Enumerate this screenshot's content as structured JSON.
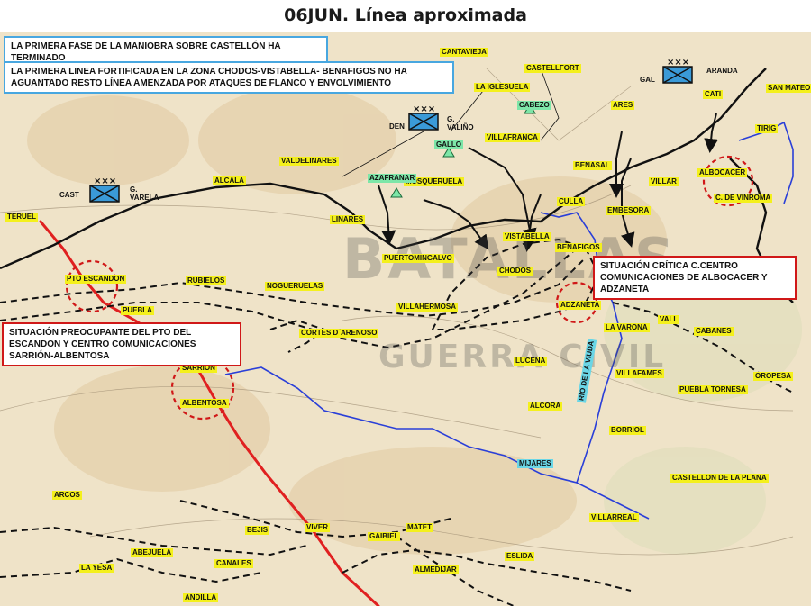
{
  "title": "06JUN. Línea aproximada",
  "notes": {
    "phase_end": "LA  PRIMERA FASE DE LA MANIOBRA SOBRE CASTELLÓN HA TERMINADO",
    "first_line": "LA  PRIMERA LINEA FORTIFICADA  EN LA ZONA CHODOS-VISTABELLA- BENAFIGOS  NO HA AGUANTADO RESTO LÍNEA AMENZADA POR ATAQUES DE FLANCO Y ENVOLVIMIENTO",
    "critical": "SITUACIÓN CRÍTICA C.CENTRO COMUNICACIONES DE ALBOCACER  Y ADZANETA",
    "worrying": "SITUACIÓN PREOCUPANTE  DEL PTO DEL ESCANDON Y CENTRO COMUNICACIONES SARRIÓN-ALBENTOSA"
  },
  "units": [
    {
      "side_label": "CAST",
      "name": "G. VARELA"
    },
    {
      "side_label": "DEN",
      "name": "G. VALIÑO"
    },
    {
      "side_label": "GAL",
      "name": "ARANDA"
    }
  ],
  "watermark": {
    "line1": "BATALLAS",
    "line2": "GUERRA CIVIL"
  },
  "places": {
    "teruel": "TERUEL",
    "pto_escandon": "PTO ESCANDON",
    "puebla": "PUEBLA",
    "sarrion": "SARRION",
    "albentosa": "ALBENTOSA",
    "arcos": "ARCOS",
    "abejuela": "ABEJUELA",
    "la_yesa": "LA YESA",
    "andilla": "ANDILLA",
    "canales": "CANALES",
    "bejis": "BEJIS",
    "viver": "VIVER",
    "gaibiel": "GAIBIEL",
    "matet": "MATET",
    "almedijar": "ALMEDIJAR",
    "eslida": "ESLIDA",
    "villarreal": "VILLARREAL",
    "castellon": "CASTELLON DE LA PLANA",
    "mijares": "MIJARES",
    "borriol": "BORRIOL",
    "puebla_tornesa": "PUEBLA TORNESA",
    "villafames": "VILLAFAMES",
    "alcora": "ALCORA",
    "lucena": "LUCENA",
    "rio_villa": "RIO DE LA VIUDA",
    "la_varona": "LA VARONA",
    "cabanes": "CABANES",
    "oropesa": "OROPESA",
    "vall": "VALL",
    "adzaneta": "ADZANETA",
    "villahermosa": "VILLAHERMOSA",
    "cortes_arenoso": "CORTES D´ARENOSO",
    "noguerelas": "NOGUERUELAS",
    "rubielos": "RUBIELOS",
    "puertomingalvo": "PUERTOMINGALVO",
    "linares": "LINARES",
    "chodos": "CHODOS",
    "vistabella": "VISTABELLA",
    "benafigos": "BENAFIGOS",
    "culla": "CULLA",
    "embesora": "EMBESORA",
    "benasal": "BENASAL",
    "villar": "VILLAR",
    "albocacer": "ALBOCACER",
    "c_vinroma": "C. DE VINROMA",
    "tirig": "TIRIG",
    "cati": "CATI",
    "san_mateo": "SAN MATEO",
    "ares": "ARES",
    "villafranca": "VILLAFRANCA",
    "la_iglesuela": "LA IGLESUELA",
    "cantavieja": "CANTAVIEJA",
    "castellfort": "CASTELLFORT",
    "mosqueruela": "MOSQUERUELA",
    "valdelinares": "VALDELINARES",
    "alcala": "ALCALA",
    "azafranar": "AZAFRANAR",
    "gallo": "GALLO",
    "cabezo": "CABEZO"
  },
  "colors": {
    "front_line": "#111111",
    "road": "#e02020",
    "river": "#2a3fd8",
    "note_blue_border": "#48a7e0",
    "note_red_border": "#d01818",
    "label_highlight": "#f4f01c",
    "hill_highlight": "#7de6a8",
    "unit_symbol": "#3a9ad8"
  }
}
